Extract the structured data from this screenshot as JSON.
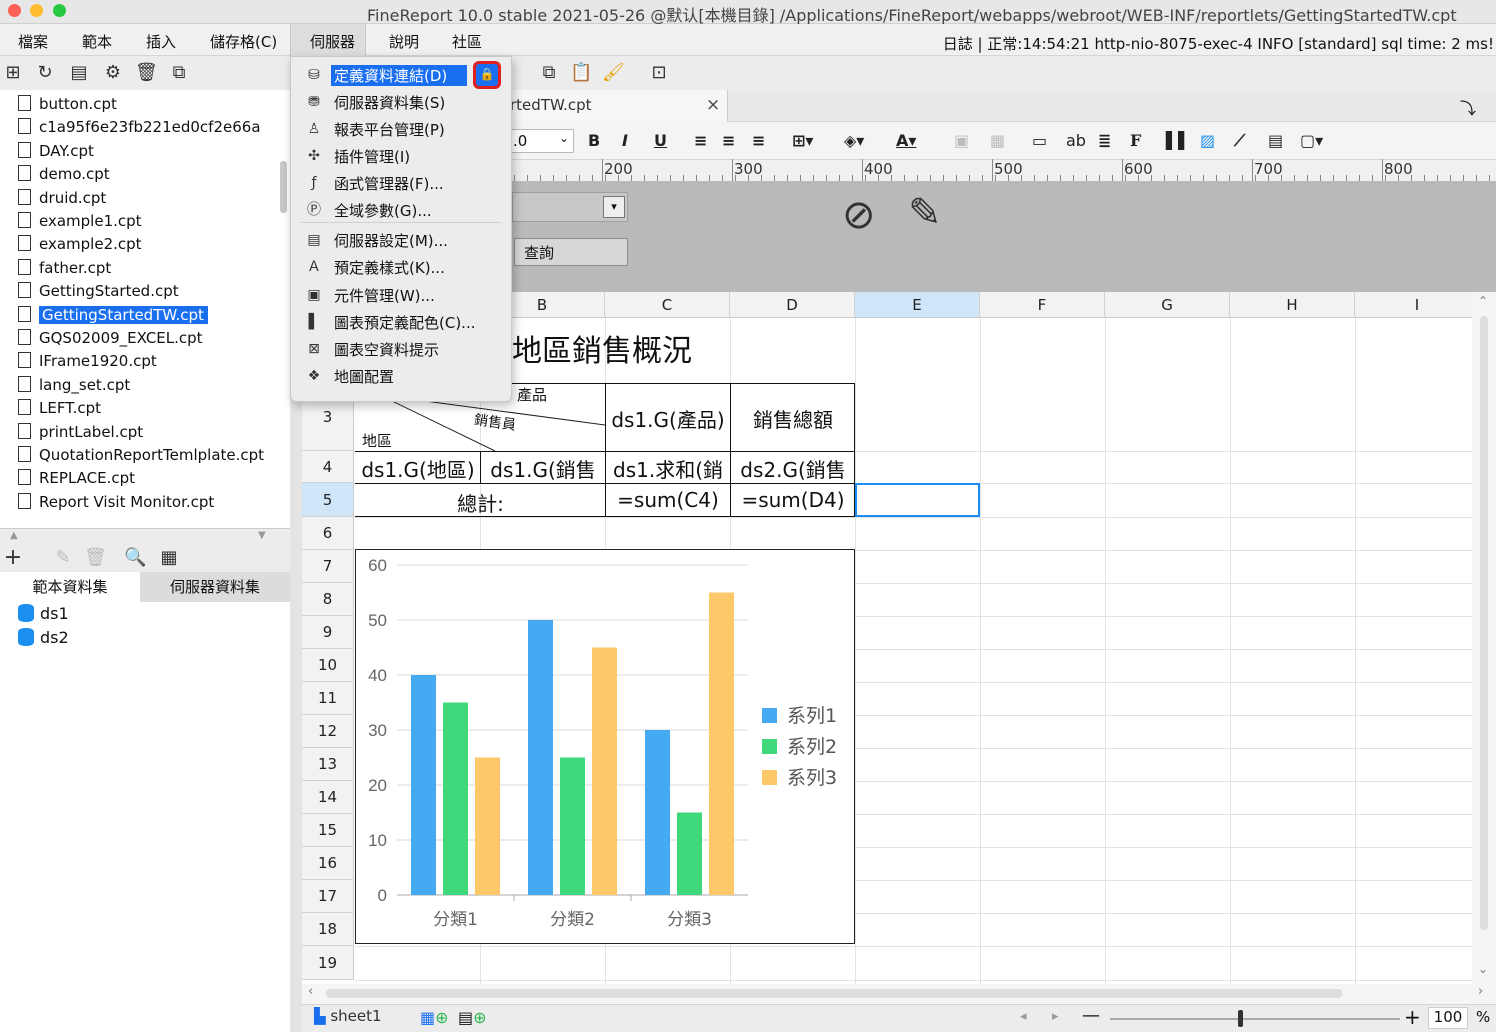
{
  "window": {
    "title": "FineReport 10.0 stable 2021-05-26 @默认[本機目錄]   /Applications/FineReport/webapps/webroot/WEB-INF/reportlets/GettingStartedTW.cpt"
  },
  "menubar": {
    "items": [
      "檔案",
      "範本",
      "插入",
      "儲存格(C)",
      "伺服器",
      "說明",
      "社區"
    ],
    "status_log": "日誌 | 正常:14:54:21 http-nio-8075-exec-4 INFO [standard] sql time: 2 ms!"
  },
  "file_tree": {
    "files": [
      "button.cpt",
      "c1a95f6e23fb221ed0cf2e66a",
      "DAY.cpt",
      "demo.cpt",
      "druid.cpt",
      "example1.cpt",
      "example2.cpt",
      "father.cpt",
      "GettingStarted.cpt",
      "GettingStartedTW.cpt",
      "GQS02009_EXCEL.cpt",
      "IFrame1920.cpt",
      "lang_set.cpt",
      "LEFT.cpt",
      "printLabel.cpt",
      "QuotationReportTemlplate.cpt",
      "REPLACE.cpt",
      "Report Visit Monitor.cpt"
    ],
    "selected": "GettingStartedTW.cpt"
  },
  "datasets": {
    "tabs": [
      "範本資料集",
      "伺服器資料集"
    ],
    "items": [
      "ds1",
      "ds2"
    ]
  },
  "server_menu": {
    "items": [
      {
        "label": "定義資料連結(D)",
        "icon": "database-connection-icon",
        "highlighted": true
      },
      {
        "label": "伺服器資料集(S)",
        "icon": "server-dataset-icon"
      },
      {
        "label": "報表平台管理(P)",
        "icon": "user-icon"
      },
      {
        "label": "插件管理(I)",
        "icon": "puzzle-icon"
      },
      {
        "label": "函式管理器(F)...",
        "icon": "function-icon"
      },
      {
        "label": "全域參數(G)...",
        "icon": "parameter-icon"
      },
      {
        "label": "伺服器設定(M)...",
        "icon": "server-settings-icon"
      },
      {
        "label": "預定義樣式(K)...",
        "icon": "style-icon"
      },
      {
        "label": "元件管理(W)...",
        "icon": "widget-icon"
      },
      {
        "label": "圖表預定義配色(C)...",
        "icon": "chart-color-icon"
      },
      {
        "label": "圖表空資料提示",
        "icon": "chart-empty-icon"
      },
      {
        "label": "地圖配置",
        "icon": "map-icon"
      }
    ]
  },
  "document": {
    "tab_label": "rtedTW.cpt",
    "font_size": ".0",
    "query_button": "查詢"
  },
  "ruler": {
    "labels": [
      "200",
      "300",
      "400",
      "500",
      "600",
      "700",
      "800"
    ]
  },
  "columns": [
    "B",
    "C",
    "D",
    "E",
    "F",
    "G",
    "H",
    "I"
  ],
  "rows": [
    "3",
    "4",
    "5",
    "6",
    "7",
    "8",
    "9",
    "10",
    "11",
    "12",
    "13",
    "14",
    "15",
    "16",
    "17",
    "18",
    "19"
  ],
  "cells": {
    "title": "地區銷售概況",
    "header_product": "產品",
    "header_salesperson": "銷售員",
    "header_region": "地區",
    "c3": "ds1.G(產品)",
    "d3": "銷售總額",
    "a4": "ds1.G(地區)",
    "b4": "ds1.G(銷售",
    "c4": "ds1.求和(銷",
    "d4": "ds2.G(銷售",
    "total_label": "總計:",
    "c5": "=sum(C4)",
    "d5": "=sum(D4)"
  },
  "chart_data": {
    "type": "bar",
    "categories": [
      "分類1",
      "分類2",
      "分類3"
    ],
    "series": [
      {
        "name": "系列1",
        "values": [
          40,
          50,
          30
        ],
        "color": "#45aaf2"
      },
      {
        "name": "系列2",
        "values": [
          35,
          25,
          15
        ],
        "color": "#3fd87a"
      },
      {
        "name": "系列3",
        "values": [
          25,
          45,
          55
        ],
        "color": "#fcc86a"
      }
    ],
    "ylim": [
      0,
      60
    ],
    "yticks": [
      "0",
      "10",
      "20",
      "30",
      "40",
      "50",
      "60"
    ],
    "legend": "right",
    "grid": true
  },
  "bottom": {
    "sheet_tab": "sheet1",
    "zoom": "100",
    "zoom_unit": "%"
  },
  "colors": {
    "accent": "#1a6ff0",
    "highlight_box": "#e02020"
  }
}
